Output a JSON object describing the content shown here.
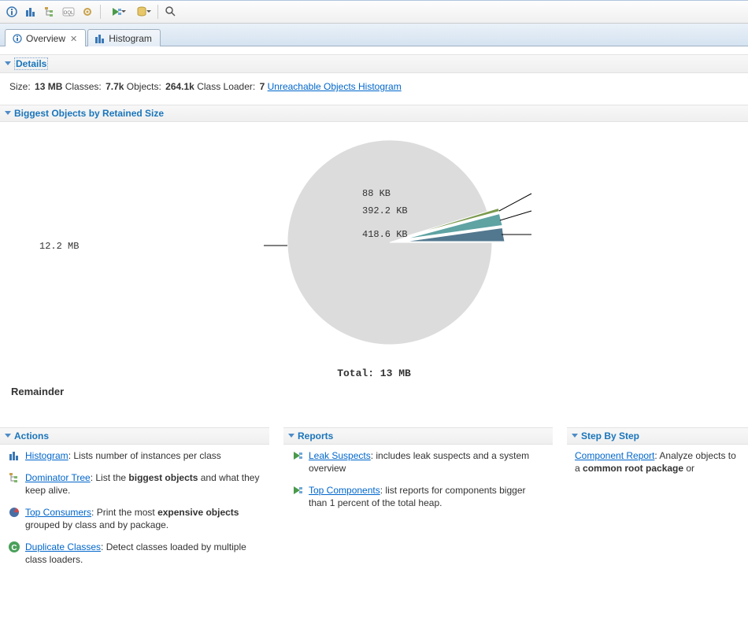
{
  "tabs": {
    "overview": "Overview",
    "histogram": "Histogram"
  },
  "sections": {
    "details_title": "Details",
    "biggest_title": "Biggest Objects by Retained Size",
    "actions_title": "Actions",
    "reports_title": "Reports",
    "step_title": "Step By Step"
  },
  "details": {
    "size_label": "Size:",
    "size_value": "13 MB",
    "classes_label": "Classes:",
    "classes_value": "7.7k",
    "objects_label": "Objects:",
    "objects_value": "264.1k",
    "loader_label": "Class Loader:",
    "loader_value": "7",
    "unreachable_link": "Unreachable Objects Histogram"
  },
  "chart_data": {
    "type": "pie",
    "title": "",
    "total_label": "Total: 13 MB",
    "slices": [
      {
        "label": "12.2 MB",
        "value_mb": 12.2,
        "color": "#dcdcdc"
      },
      {
        "label": "418.6 KB",
        "value_mb": 0.409,
        "color": "#52788f"
      },
      {
        "label": "392.2 KB",
        "value_mb": 0.383,
        "color": "#5fa3a3"
      },
      {
        "label": "88 KB",
        "value_mb": 0.086,
        "color": "#7b9a4e"
      }
    ],
    "remainder_label": "Remainder"
  },
  "actions": {
    "histogram_link": "Histogram",
    "histogram_desc": ": Lists number of instances per class",
    "dominator_link": "Dominator Tree",
    "dominator_desc_a": ": List the ",
    "dominator_desc_b": "biggest objects",
    "dominator_desc_c": " and what they keep alive.",
    "topcons_link": "Top Consumers",
    "topcons_desc_a": ": Print the most ",
    "topcons_desc_b": "expensive objects",
    "topcons_desc_c": " grouped by class and by package.",
    "dup_link": "Duplicate Classes",
    "dup_desc": ": Detect classes loaded by multiple class loaders."
  },
  "reports": {
    "leak_link": "Leak Suspects",
    "leak_desc": ": includes leak suspects and a system overview",
    "topcomp_link": "Top Components",
    "topcomp_desc": ": list reports for components bigger than 1 percent of the total heap."
  },
  "step": {
    "comp_link": "Component Report",
    "comp_desc_a": ": Analyze objects",
    "comp_desc_b": " to a ",
    "comp_desc_c": "common root package",
    "comp_desc_d": " or"
  }
}
